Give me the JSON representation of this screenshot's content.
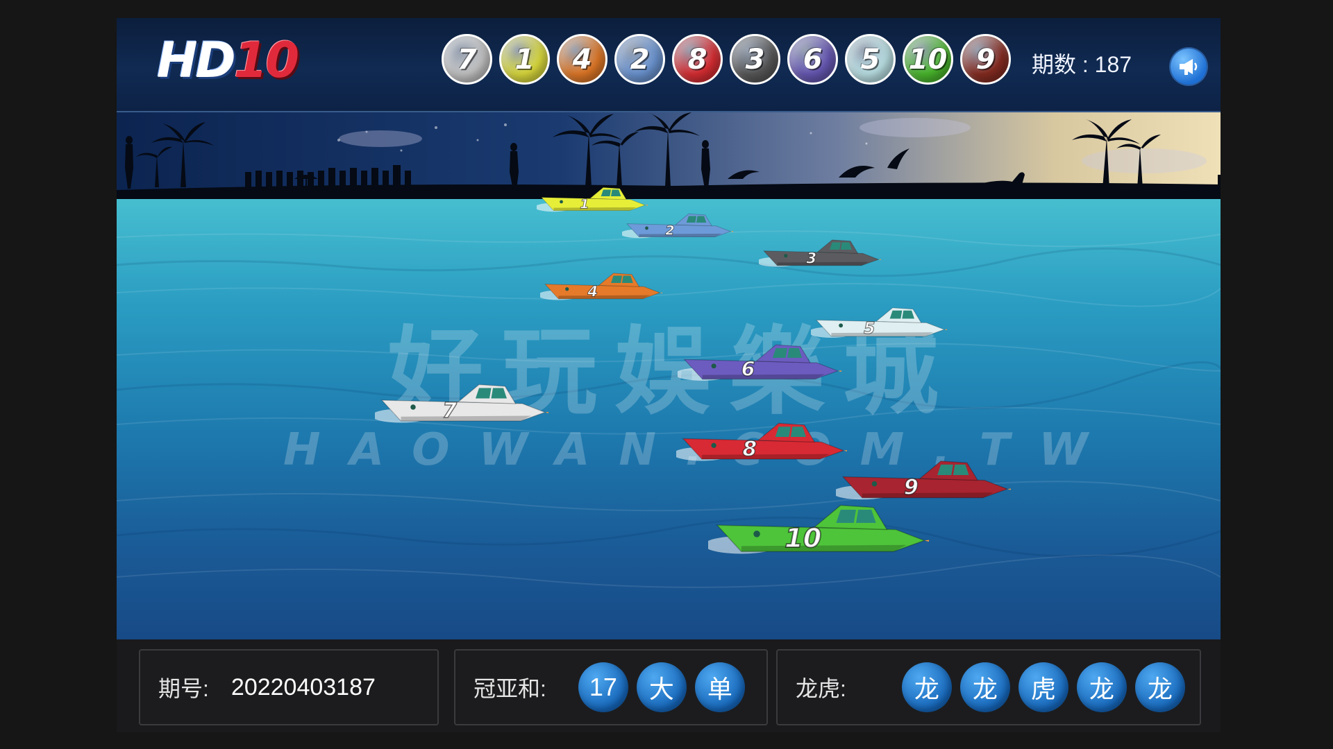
{
  "header": {
    "logo_main": "HD",
    "logo_num": "10",
    "period_label": "期数 : 187",
    "balls": [
      {
        "number": "7",
        "color": "#c9c9c9"
      },
      {
        "number": "1",
        "color": "#e0df3e"
      },
      {
        "number": "4",
        "color": "#e67b28"
      },
      {
        "number": "2",
        "color": "#6e98d6"
      },
      {
        "number": "8",
        "color": "#de2f34"
      },
      {
        "number": "3",
        "color": "#5a5a5a"
      },
      {
        "number": "6",
        "color": "#6a5ab8"
      },
      {
        "number": "5",
        "color": "#bfe6ea"
      },
      {
        "number": "10",
        "color": "#4cbd2e"
      },
      {
        "number": "9",
        "color": "#8a2d22"
      }
    ]
  },
  "scene": {
    "watermark_cn": "好玩娛樂城",
    "watermark_en": "HAOWAN.COM.TW",
    "boats": [
      {
        "number": "1",
        "color": "#e6ee38"
      },
      {
        "number": "2",
        "color": "#6d9ad8"
      },
      {
        "number": "3",
        "color": "#5c5c60"
      },
      {
        "number": "4",
        "color": "#e57a2a"
      },
      {
        "number": "5",
        "color": "#dfeff2"
      },
      {
        "number": "6",
        "color": "#6c5cc0"
      },
      {
        "number": "7",
        "color": "#e8e8e8"
      },
      {
        "number": "8",
        "color": "#d82a34"
      },
      {
        "number": "9",
        "color": "#a82430"
      },
      {
        "number": "10",
        "color": "#4ec43a"
      }
    ]
  },
  "footer": {
    "issue_label": "期号:",
    "issue_value": "20220403187",
    "sum_label": "冠亚和:",
    "sum_chips": [
      "17",
      "大",
      "单"
    ],
    "dragon_label": "龙虎:",
    "dragon_chips": [
      "龙",
      "龙",
      "虎",
      "龙",
      "龙"
    ]
  },
  "colors": {
    "accent": "#1565b8",
    "header_bg": "#0c1e3c",
    "page_bg": "#161616"
  }
}
